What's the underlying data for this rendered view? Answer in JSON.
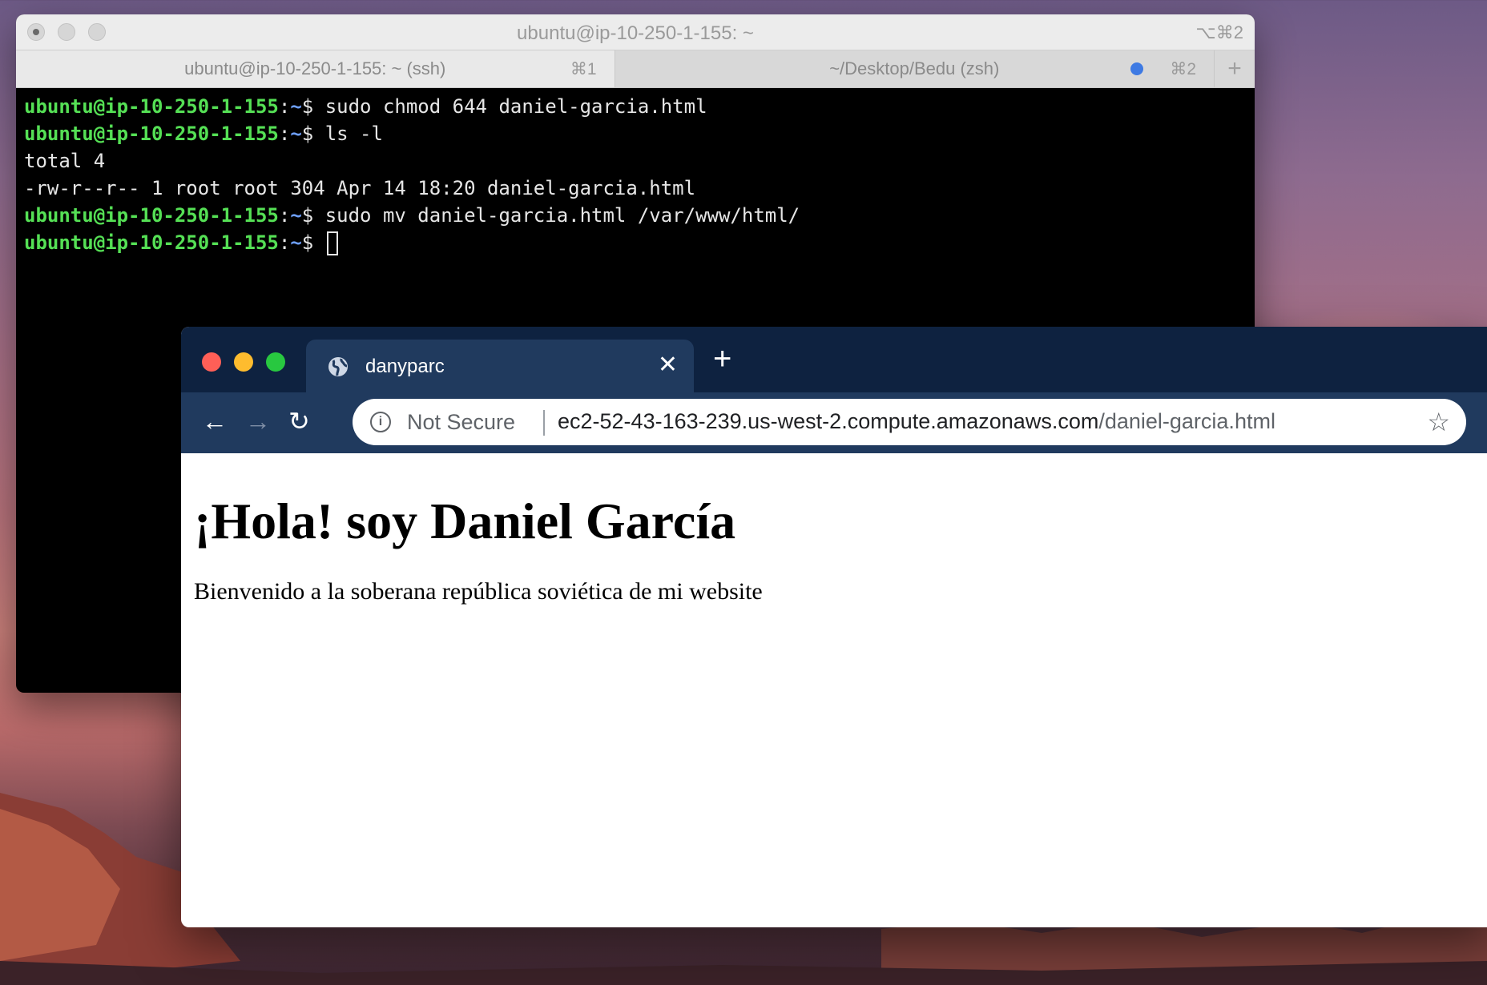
{
  "terminal": {
    "window_title": "ubuntu@ip-10-250-1-155: ~",
    "window_shortcut": "⌥⌘2",
    "tabs": [
      {
        "label": "ubuntu@ip-10-250-1-155: ~ (ssh)",
        "shortcut": "⌘1"
      },
      {
        "label": "~/Desktop/Bedu (zsh)",
        "shortcut": "⌘2"
      }
    ],
    "new_tab_icon": "+",
    "prompt": {
      "user": "ubuntu@ip-10-250-1-155",
      "colon": ":",
      "path": "~",
      "symbol": "$ "
    },
    "commands": [
      "sudo chmod 644 daniel-garcia.html",
      "ls -l",
      "sudo mv daniel-garcia.html /var/www/html/"
    ],
    "outputs": [
      "total 4",
      "-rw-r--r-- 1 root root 304 Apr 14 18:20 daniel-garcia.html"
    ]
  },
  "browser": {
    "tab_title": "danyparc",
    "tab_close_icon": "✕",
    "new_tab_icon": "+",
    "back_icon": "←",
    "forward_icon": "→",
    "reload_icon": "↻",
    "security_text": "Not Secure",
    "url_host": "ec2-52-43-163-239.us-west-2.compute.amazonaws.com",
    "url_path": "/daniel-garcia.html",
    "star_icon": "☆",
    "page": {
      "heading": "¡Hola! soy Daniel García",
      "paragraph": "Bienvenido a la soberana república soviética de mi website"
    }
  },
  "colors": {
    "prompt_user": "#55e055",
    "prompt_path": "#6ea0ff",
    "browser_frame": "#0e2240",
    "browser_toolbar": "#203a5e",
    "close_light": "#ff5f57",
    "minimize_light": "#febc2e",
    "zoom_light": "#28c840"
  }
}
